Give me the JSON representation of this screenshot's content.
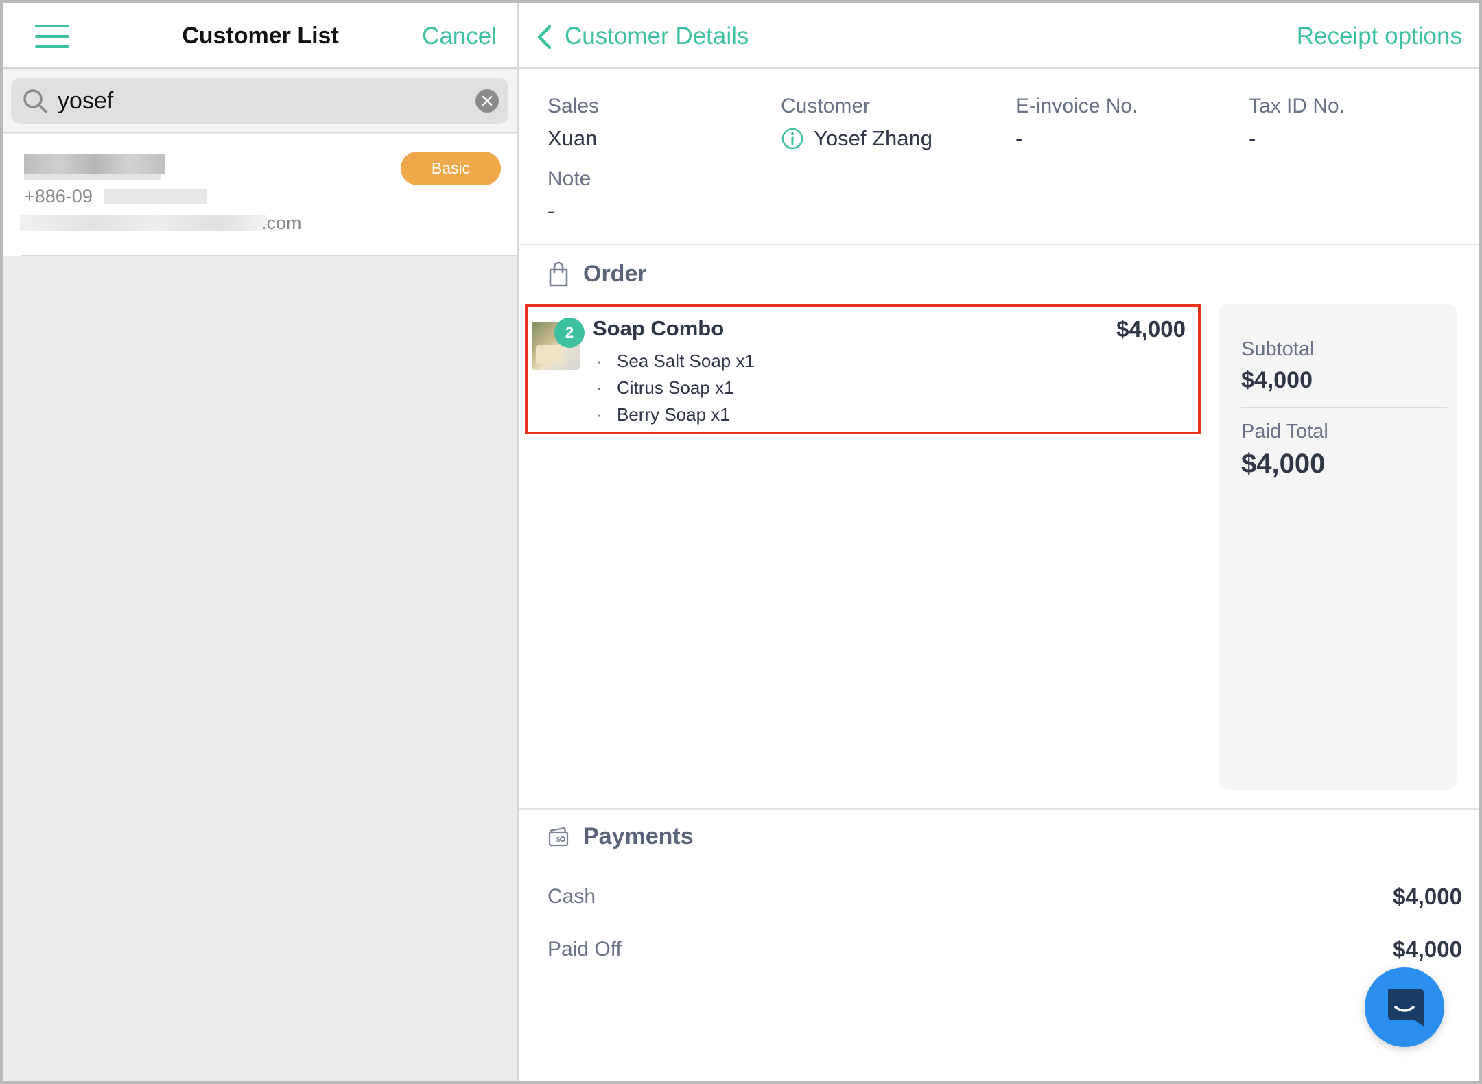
{
  "left_pane": {
    "title": "Customer List",
    "cancel_label": "Cancel",
    "search": {
      "value": "yosef",
      "placeholder": ""
    },
    "customer_card": {
      "phone_prefix": "+886-09",
      "email_suffix": ".com",
      "badge": "Basic"
    }
  },
  "right_pane": {
    "back_label": "Customer Details",
    "receipt_options_label": "Receipt options",
    "info": {
      "sales_label": "Sales",
      "sales_value": "Xuan",
      "customer_label": "Customer",
      "customer_value": "Yosef Zhang",
      "einvoice_label": "E-invoice No.",
      "einvoice_value": "-",
      "taxid_label": "Tax ID No.",
      "taxid_value": "-",
      "note_label": "Note",
      "note_value": "-"
    },
    "order": {
      "title": "Order",
      "item": {
        "quantity": "2",
        "name": "Soap Combo",
        "price": "$4,000",
        "bullet": "·",
        "sub_items": [
          "Sea Salt Soap x1",
          "Citrus Soap x1",
          "Berry Soap x1"
        ]
      }
    },
    "summary": {
      "subtotal_label": "Subtotal",
      "subtotal_value": "$4,000",
      "paid_total_label": "Paid Total",
      "paid_total_value": "$4,000"
    },
    "payments": {
      "title": "Payments",
      "rows": [
        {
          "label": "Cash",
          "value": "$4,000"
        },
        {
          "label": "Paid Off",
          "value": "$4,000"
        }
      ]
    }
  },
  "colors": {
    "accent": "#3ec1a1",
    "badge": "#f0a94a",
    "highlight": "#e8321f",
    "chat_button": "#2b8ff0"
  },
  "icons": {
    "menu": "hamburger-menu-icon",
    "search": "search-icon",
    "clear": "clear-icon",
    "back": "chevron-left-icon",
    "customer_info": "info-icon",
    "order": "shopping-bag-icon",
    "payments": "wallet-icon",
    "chat": "chat-icon"
  }
}
